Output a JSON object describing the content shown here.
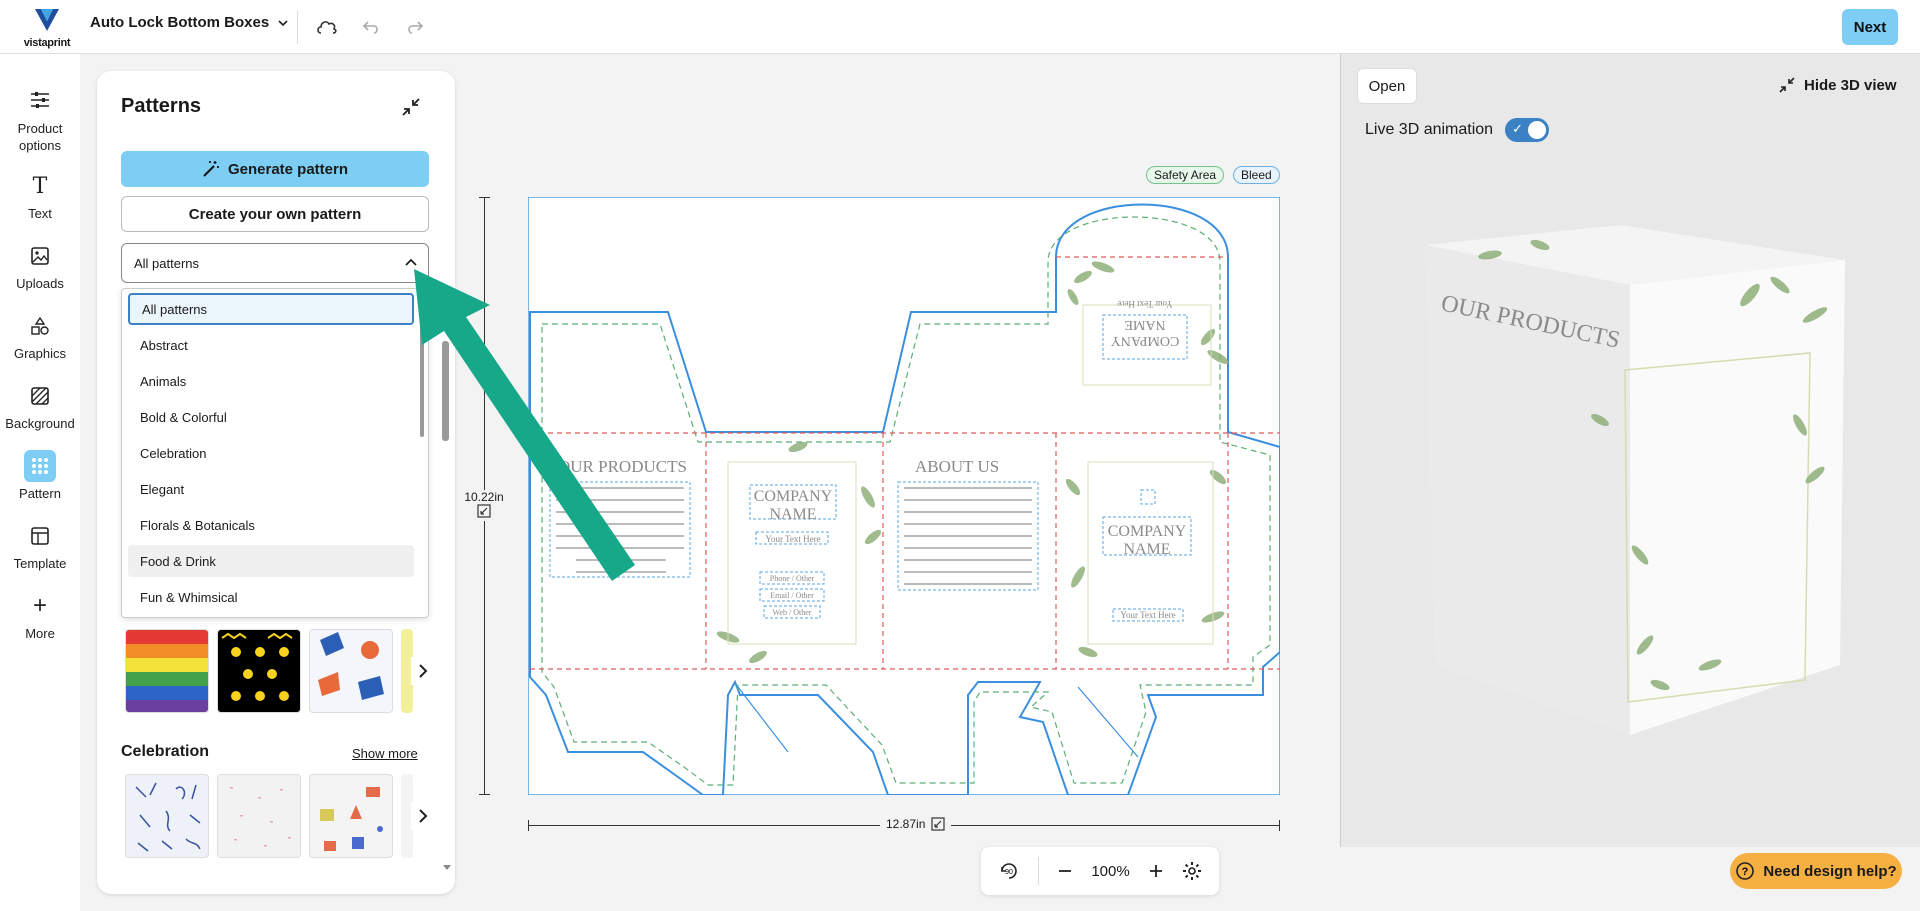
{
  "header": {
    "logo_text": "vistaprint",
    "doc_title": "Auto Lock Bottom Boxes",
    "next_label": "Next"
  },
  "rail": [
    {
      "label": "Product options",
      "icon": "sliders-icon"
    },
    {
      "label": "Text",
      "icon": "text-icon"
    },
    {
      "label": "Uploads",
      "icon": "image-upload-icon"
    },
    {
      "label": "Graphics",
      "icon": "shapes-icon"
    },
    {
      "label": "Background",
      "icon": "background-icon"
    },
    {
      "label": "Pattern",
      "icon": "grid-dots-icon",
      "active": true
    },
    {
      "label": "Template",
      "icon": "template-icon"
    },
    {
      "label": "More",
      "icon": "plus-icon"
    }
  ],
  "panel": {
    "title": "Patterns",
    "generate_label": "Generate pattern",
    "create_label": "Create your own pattern",
    "select_value": "All patterns",
    "options": [
      "All patterns",
      "Abstract",
      "Animals",
      "Bold & Colorful",
      "Celebration",
      "Elegant",
      "Florals & Botanicals",
      "Food & Drink",
      "Fun & Whimsical"
    ],
    "selected_index": 0,
    "hover_index": 7,
    "section2_title": "Celebration",
    "show_more": "Show more"
  },
  "canvas": {
    "safety_label": "Safety Area",
    "bleed_label": "Bleed",
    "height_label": "10.22in",
    "width_label": "12.87in",
    "panel_texts": {
      "our_products": "OUR PRODUCTS",
      "about_us": "ABOUT US",
      "company": "COMPANY",
      "name": "NAME",
      "your_text": "Your Text Here",
      "phone": "Phone / Other",
      "email": "Email / Other",
      "web": "Web / Other"
    }
  },
  "zoom": {
    "value": "100%"
  },
  "view3d": {
    "open_label": "Open",
    "hide_label": "Hide 3D view",
    "live_label": "Live 3D animation",
    "box_text": "OUR PRODUCTS"
  },
  "help": {
    "label": "Need design help?"
  },
  "colors": {
    "accent": "#7dcdf4",
    "toggle": "#3b82c4",
    "arrow": "#17a88a",
    "help": "#f5b041"
  }
}
